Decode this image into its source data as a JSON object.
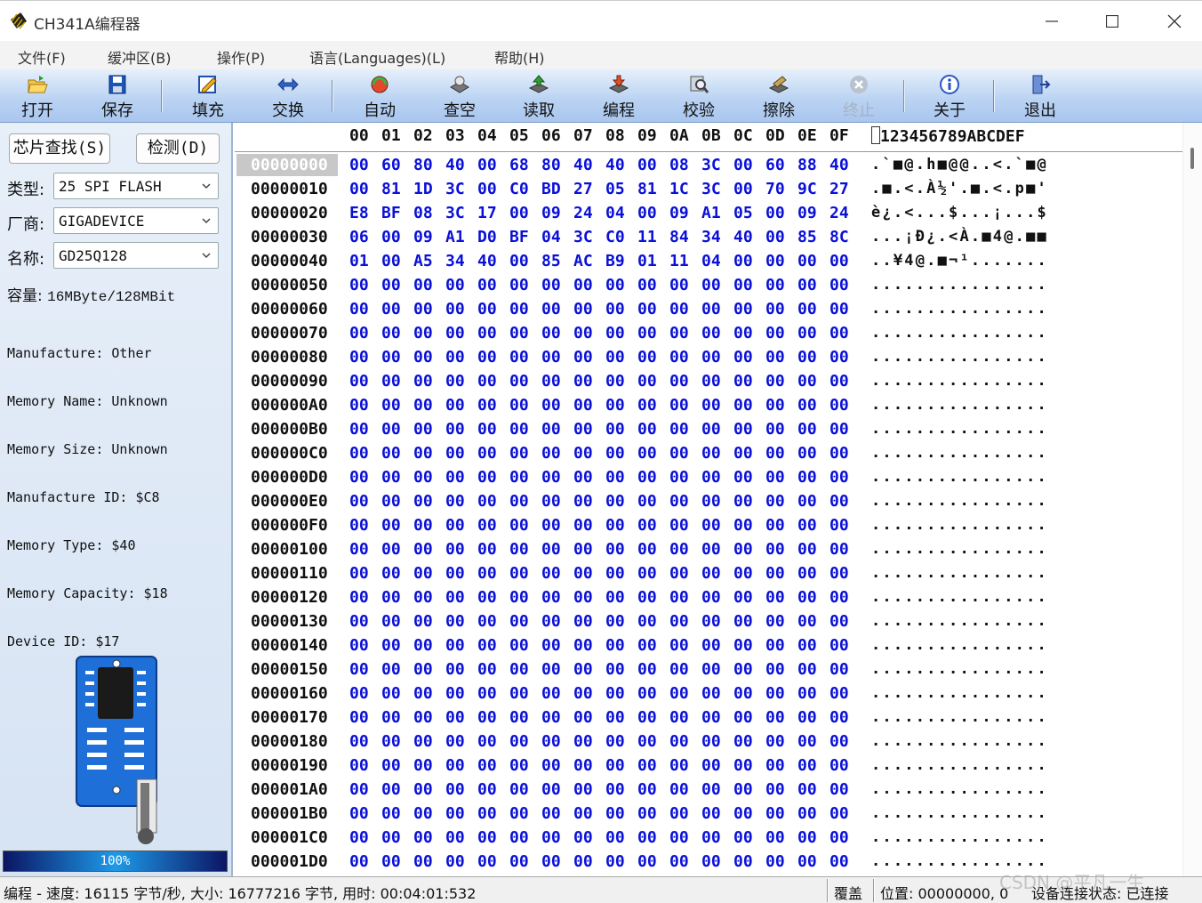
{
  "window": {
    "title": "CH341A编程器"
  },
  "menu": [
    "文件(F)",
    "缓冲区(B)",
    "操作(P)",
    "语言(Languages)(L)",
    "帮助(H)"
  ],
  "toolbar": [
    {
      "label": "打开",
      "icon": "folder-open-icon",
      "enabled": true
    },
    {
      "label": "保存",
      "icon": "floppy-save-icon",
      "enabled": true
    },
    {
      "label": "填充",
      "icon": "fill-edit-icon",
      "enabled": true
    },
    {
      "label": "交换",
      "icon": "swap-arrows-icon",
      "enabled": true
    },
    {
      "label": "自动",
      "icon": "auto-chip-icon",
      "enabled": true
    },
    {
      "label": "查空",
      "icon": "blank-check-icon",
      "enabled": true
    },
    {
      "label": "读取",
      "icon": "read-chip-icon",
      "enabled": true
    },
    {
      "label": "编程",
      "icon": "program-chip-icon",
      "enabled": true
    },
    {
      "label": "校验",
      "icon": "verify-magnifier-icon",
      "enabled": true
    },
    {
      "label": "擦除",
      "icon": "erase-chip-icon",
      "enabled": true
    },
    {
      "label": "终止",
      "icon": "stop-x-icon",
      "enabled": false
    },
    {
      "label": "关于",
      "icon": "info-icon",
      "enabled": true
    },
    {
      "label": "退出",
      "icon": "exit-door-icon",
      "enabled": true
    }
  ],
  "left": {
    "find_btn": "芯片查找(S)",
    "detect_btn": "检测(D)",
    "type_label": "类型:",
    "type_value": "25 SPI FLASH",
    "vendor_label": "厂商:",
    "vendor_value": "GIGADEVICE",
    "name_label": "名称:",
    "name_value": "GD25Q128",
    "capacity_label": "容量:",
    "capacity_value": "16MByte/128MBit",
    "info": [
      "Manufacture: Other",
      "Memory Name: Unknown",
      "Memory Size: Unknown",
      "Manufacture ID: $C8",
      "Memory Type: $40",
      "Memory Capacity: $18",
      "Device ID: $17"
    ],
    "progress_percent": 100,
    "progress_text": "100%"
  },
  "hex": {
    "columns": [
      "00",
      "01",
      "02",
      "03",
      "04",
      "05",
      "06",
      "07",
      "08",
      "09",
      "0A",
      "0B",
      "0C",
      "0D",
      "0E",
      "0F"
    ],
    "ascii_header": "123456789ABCDEF",
    "rows": [
      {
        "addr": "00000000",
        "bytes": [
          "00",
          "60",
          "80",
          "40",
          "00",
          "68",
          "80",
          "40",
          "40",
          "00",
          "08",
          "3C",
          "00",
          "60",
          "88",
          "40"
        ],
        "ascii": ".`■@.h■@@..<.`■@"
      },
      {
        "addr": "00000010",
        "bytes": [
          "00",
          "81",
          "1D",
          "3C",
          "00",
          "C0",
          "BD",
          "27",
          "05",
          "81",
          "1C",
          "3C",
          "00",
          "70",
          "9C",
          "27"
        ],
        "ascii": ".■.<.À½'.■.<.p■'"
      },
      {
        "addr": "00000020",
        "bytes": [
          "E8",
          "BF",
          "08",
          "3C",
          "17",
          "00",
          "09",
          "24",
          "04",
          "00",
          "09",
          "A1",
          "05",
          "00",
          "09",
          "24"
        ],
        "ascii": "è¿.<...$...¡...$"
      },
      {
        "addr": "00000030",
        "bytes": [
          "06",
          "00",
          "09",
          "A1",
          "D0",
          "BF",
          "04",
          "3C",
          "C0",
          "11",
          "84",
          "34",
          "40",
          "00",
          "85",
          "8C"
        ],
        "ascii": "...¡Ð¿.<À.■4@.■■"
      },
      {
        "addr": "00000040",
        "bytes": [
          "01",
          "00",
          "A5",
          "34",
          "40",
          "00",
          "85",
          "AC",
          "B9",
          "01",
          "11",
          "04",
          "00",
          "00",
          "00",
          "00"
        ],
        "ascii": "..¥4@.■¬¹......."
      },
      {
        "addr": "00000050",
        "bytes": [
          "00",
          "00",
          "00",
          "00",
          "00",
          "00",
          "00",
          "00",
          "00",
          "00",
          "00",
          "00",
          "00",
          "00",
          "00",
          "00"
        ],
        "ascii": "................"
      },
      {
        "addr": "00000060",
        "bytes": [
          "00",
          "00",
          "00",
          "00",
          "00",
          "00",
          "00",
          "00",
          "00",
          "00",
          "00",
          "00",
          "00",
          "00",
          "00",
          "00"
        ],
        "ascii": "................"
      },
      {
        "addr": "00000070",
        "bytes": [
          "00",
          "00",
          "00",
          "00",
          "00",
          "00",
          "00",
          "00",
          "00",
          "00",
          "00",
          "00",
          "00",
          "00",
          "00",
          "00"
        ],
        "ascii": "................"
      },
      {
        "addr": "00000080",
        "bytes": [
          "00",
          "00",
          "00",
          "00",
          "00",
          "00",
          "00",
          "00",
          "00",
          "00",
          "00",
          "00",
          "00",
          "00",
          "00",
          "00"
        ],
        "ascii": "................"
      },
      {
        "addr": "00000090",
        "bytes": [
          "00",
          "00",
          "00",
          "00",
          "00",
          "00",
          "00",
          "00",
          "00",
          "00",
          "00",
          "00",
          "00",
          "00",
          "00",
          "00"
        ],
        "ascii": "................"
      },
      {
        "addr": "000000A0",
        "bytes": [
          "00",
          "00",
          "00",
          "00",
          "00",
          "00",
          "00",
          "00",
          "00",
          "00",
          "00",
          "00",
          "00",
          "00",
          "00",
          "00"
        ],
        "ascii": "................"
      },
      {
        "addr": "000000B0",
        "bytes": [
          "00",
          "00",
          "00",
          "00",
          "00",
          "00",
          "00",
          "00",
          "00",
          "00",
          "00",
          "00",
          "00",
          "00",
          "00",
          "00"
        ],
        "ascii": "................"
      },
      {
        "addr": "000000C0",
        "bytes": [
          "00",
          "00",
          "00",
          "00",
          "00",
          "00",
          "00",
          "00",
          "00",
          "00",
          "00",
          "00",
          "00",
          "00",
          "00",
          "00"
        ],
        "ascii": "................"
      },
      {
        "addr": "000000D0",
        "bytes": [
          "00",
          "00",
          "00",
          "00",
          "00",
          "00",
          "00",
          "00",
          "00",
          "00",
          "00",
          "00",
          "00",
          "00",
          "00",
          "00"
        ],
        "ascii": "................"
      },
      {
        "addr": "000000E0",
        "bytes": [
          "00",
          "00",
          "00",
          "00",
          "00",
          "00",
          "00",
          "00",
          "00",
          "00",
          "00",
          "00",
          "00",
          "00",
          "00",
          "00"
        ],
        "ascii": "................"
      },
      {
        "addr": "000000F0",
        "bytes": [
          "00",
          "00",
          "00",
          "00",
          "00",
          "00",
          "00",
          "00",
          "00",
          "00",
          "00",
          "00",
          "00",
          "00",
          "00",
          "00"
        ],
        "ascii": "................"
      },
      {
        "addr": "00000100",
        "bytes": [
          "00",
          "00",
          "00",
          "00",
          "00",
          "00",
          "00",
          "00",
          "00",
          "00",
          "00",
          "00",
          "00",
          "00",
          "00",
          "00"
        ],
        "ascii": "................"
      },
      {
        "addr": "00000110",
        "bytes": [
          "00",
          "00",
          "00",
          "00",
          "00",
          "00",
          "00",
          "00",
          "00",
          "00",
          "00",
          "00",
          "00",
          "00",
          "00",
          "00"
        ],
        "ascii": "................"
      },
      {
        "addr": "00000120",
        "bytes": [
          "00",
          "00",
          "00",
          "00",
          "00",
          "00",
          "00",
          "00",
          "00",
          "00",
          "00",
          "00",
          "00",
          "00",
          "00",
          "00"
        ],
        "ascii": "................"
      },
      {
        "addr": "00000130",
        "bytes": [
          "00",
          "00",
          "00",
          "00",
          "00",
          "00",
          "00",
          "00",
          "00",
          "00",
          "00",
          "00",
          "00",
          "00",
          "00",
          "00"
        ],
        "ascii": "................"
      },
      {
        "addr": "00000140",
        "bytes": [
          "00",
          "00",
          "00",
          "00",
          "00",
          "00",
          "00",
          "00",
          "00",
          "00",
          "00",
          "00",
          "00",
          "00",
          "00",
          "00"
        ],
        "ascii": "................"
      },
      {
        "addr": "00000150",
        "bytes": [
          "00",
          "00",
          "00",
          "00",
          "00",
          "00",
          "00",
          "00",
          "00",
          "00",
          "00",
          "00",
          "00",
          "00",
          "00",
          "00"
        ],
        "ascii": "................"
      },
      {
        "addr": "00000160",
        "bytes": [
          "00",
          "00",
          "00",
          "00",
          "00",
          "00",
          "00",
          "00",
          "00",
          "00",
          "00",
          "00",
          "00",
          "00",
          "00",
          "00"
        ],
        "ascii": "................"
      },
      {
        "addr": "00000170",
        "bytes": [
          "00",
          "00",
          "00",
          "00",
          "00",
          "00",
          "00",
          "00",
          "00",
          "00",
          "00",
          "00",
          "00",
          "00",
          "00",
          "00"
        ],
        "ascii": "................"
      },
      {
        "addr": "00000180",
        "bytes": [
          "00",
          "00",
          "00",
          "00",
          "00",
          "00",
          "00",
          "00",
          "00",
          "00",
          "00",
          "00",
          "00",
          "00",
          "00",
          "00"
        ],
        "ascii": "................"
      },
      {
        "addr": "00000190",
        "bytes": [
          "00",
          "00",
          "00",
          "00",
          "00",
          "00",
          "00",
          "00",
          "00",
          "00",
          "00",
          "00",
          "00",
          "00",
          "00",
          "00"
        ],
        "ascii": "................"
      },
      {
        "addr": "000001A0",
        "bytes": [
          "00",
          "00",
          "00",
          "00",
          "00",
          "00",
          "00",
          "00",
          "00",
          "00",
          "00",
          "00",
          "00",
          "00",
          "00",
          "00"
        ],
        "ascii": "................"
      },
      {
        "addr": "000001B0",
        "bytes": [
          "00",
          "00",
          "00",
          "00",
          "00",
          "00",
          "00",
          "00",
          "00",
          "00",
          "00",
          "00",
          "00",
          "00",
          "00",
          "00"
        ],
        "ascii": "................"
      },
      {
        "addr": "000001C0",
        "bytes": [
          "00",
          "00",
          "00",
          "00",
          "00",
          "00",
          "00",
          "00",
          "00",
          "00",
          "00",
          "00",
          "00",
          "00",
          "00",
          "00"
        ],
        "ascii": "................"
      },
      {
        "addr": "000001D0",
        "bytes": [
          "00",
          "00",
          "00",
          "00",
          "00",
          "00",
          "00",
          "00",
          "00",
          "00",
          "00",
          "00",
          "00",
          "00",
          "00",
          "00"
        ],
        "ascii": "................"
      }
    ]
  },
  "status": {
    "main": "编程 - 速度: 16115 字节/秒, 大小: 16777216 字节, 用时: 00:04:01:532",
    "mode": "覆盖",
    "position": "位置: 00000000, 0",
    "connection": "设备连接状态: 已连接"
  },
  "watermark": "CSDN @平凡一生",
  "colors": {
    "hex_bytes": "#0a10d8",
    "toolbar_top": "#e6f0fb",
    "toolbar_bottom": "#a9c6ef",
    "panel": "#dce7f5"
  }
}
